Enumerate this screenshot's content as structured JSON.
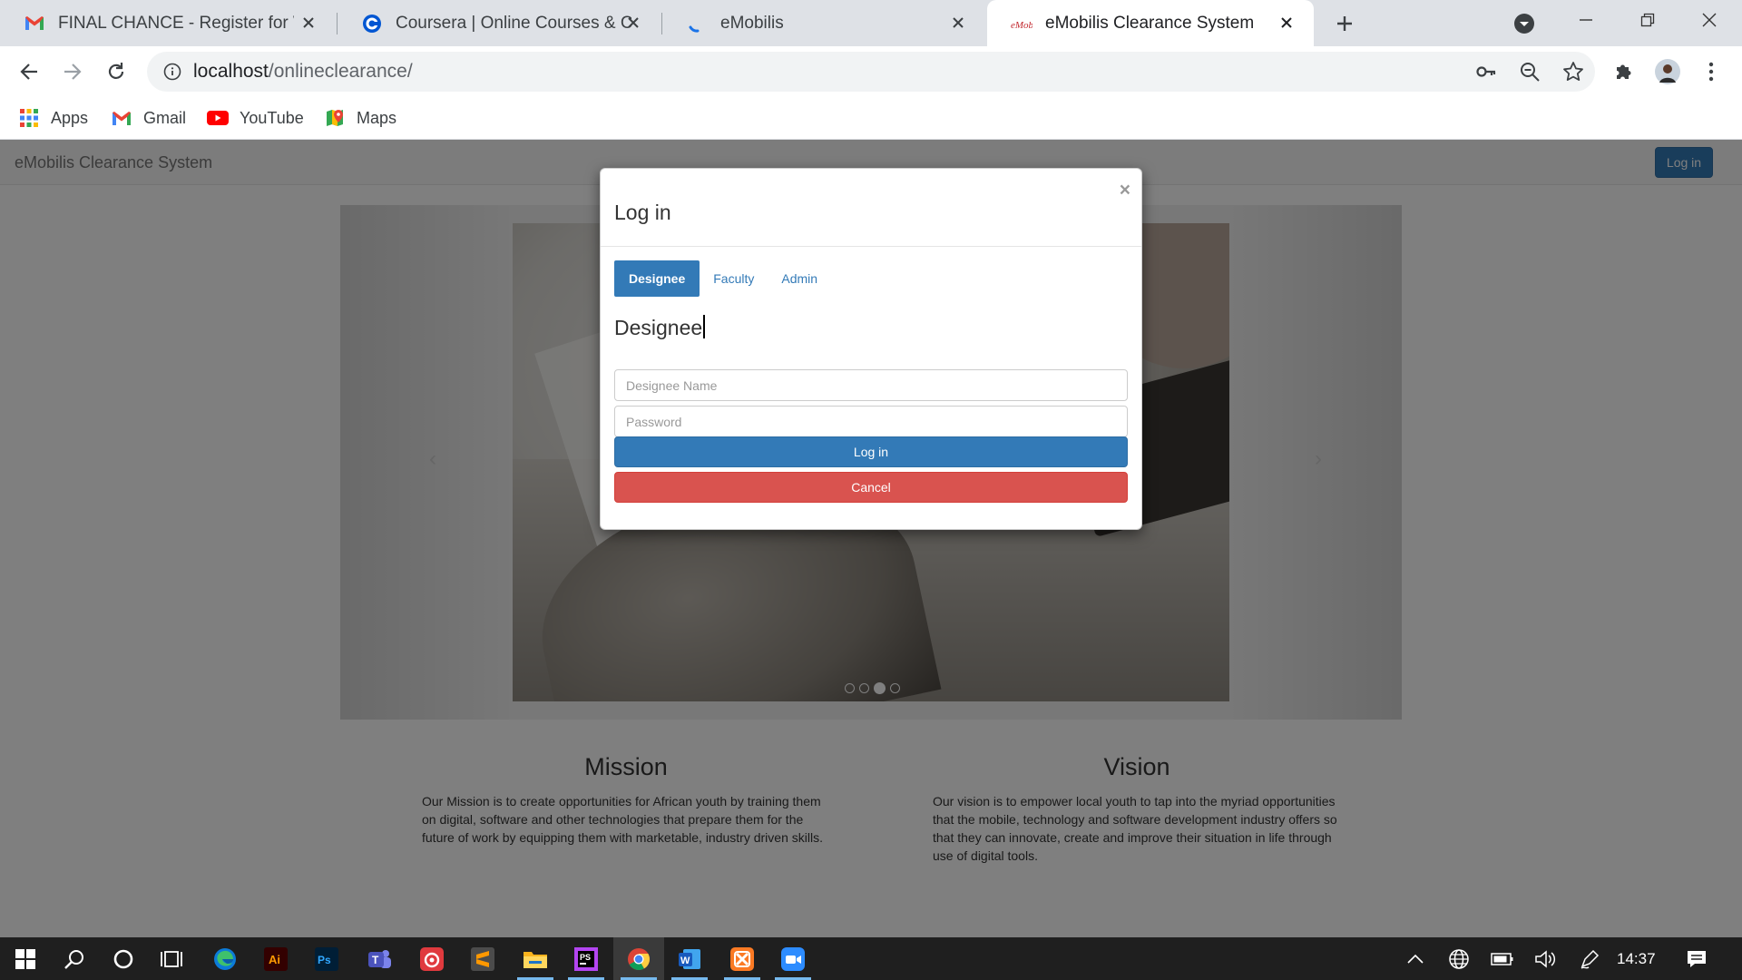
{
  "browser": {
    "tabs": [
      {
        "title": "FINAL CHANCE - Register for Wo",
        "icon": "gmail-icon",
        "active": false
      },
      {
        "title": "Coursera | Online Courses & Cre",
        "icon": "coursera-icon",
        "active": false
      },
      {
        "title": "eMobilis",
        "icon": "loading-icon",
        "active": false
      },
      {
        "title": "eMobilis Clearance System",
        "icon": "emobilis-icon",
        "active": true
      }
    ],
    "address": {
      "host": "localhost",
      "path": "/onlineclearance/"
    },
    "bookmarks": [
      {
        "label": "Apps",
        "icon": "apps-grid-icon"
      },
      {
        "label": "Gmail",
        "icon": "gmail-icon"
      },
      {
        "label": "YouTube",
        "icon": "youtube-icon"
      },
      {
        "label": "Maps",
        "icon": "maps-icon"
      }
    ]
  },
  "page": {
    "navbar": {
      "brand": "eMobilis Clearance System",
      "login_label": "Log in"
    },
    "carousel": {
      "prev": "‹",
      "next": "›",
      "indicator_count": 4,
      "active_index": 2
    },
    "mission": {
      "title": "Mission",
      "text": "Our Mission is to create opportunities for African youth by training them on digital, software and other technologies that prepare them for the future of work by equipping them with marketable, industry driven skills."
    },
    "vision": {
      "title": "Vision",
      "text": "Our vision is to empower local youth to tap into the myriad opportunities that the mobile, technology and software development industry offers so that they can innovate, create and improve their situation in life through use of digital tools."
    }
  },
  "modal": {
    "title": "Log in",
    "close": "×",
    "tabs": [
      {
        "label": "Designee",
        "active": true
      },
      {
        "label": "Faculty",
        "active": false
      },
      {
        "label": "Admin",
        "active": false
      }
    ],
    "form_heading": "Designee",
    "name_placeholder": "Designee Name",
    "password_placeholder": "Password",
    "login_label": "Log in",
    "cancel_label": "Cancel"
  },
  "taskbar": {
    "clock": "14:37",
    "apps": [
      "start-icon",
      "search-icon",
      "cortana-icon",
      "task-view-icon",
      "edge-icon",
      "illustrator-icon",
      "photoshop-icon",
      "teams-icon",
      "app-icon",
      "sublime-icon",
      "file-explorer-icon",
      "phpstorm-icon",
      "chrome-icon",
      "word-icon",
      "xampp-icon",
      "zoom-icon"
    ]
  },
  "colors": {
    "primary": "#337ab7",
    "danger": "#d9534f",
    "tab_strip": "#dee1e6",
    "taskbar": "#1f1f1f"
  }
}
